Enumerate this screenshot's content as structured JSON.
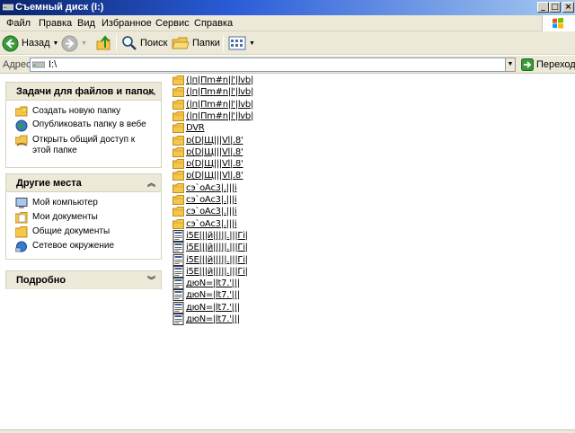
{
  "window": {
    "title": "Съемный диск (I:)"
  },
  "menu": [
    "Файл",
    "Правка",
    "Вид",
    "Избранное",
    "Сервис",
    "Справка"
  ],
  "toolbar": {
    "back": "Назад",
    "search": "Поиск",
    "folders": "Папки"
  },
  "address": {
    "label": "Адрес:",
    "value": "I:\\",
    "go": "Переход"
  },
  "panels": {
    "tasks": {
      "title": "Задачи для файлов и папок",
      "items": [
        "Создать новую папку",
        "Опубликовать папку в вебе",
        "Открыть общий доступ к этой папке"
      ]
    },
    "places": {
      "title": "Другие места",
      "items": [
        "Мой компьютер",
        "Мои документы",
        "Общие документы",
        "Сетевое окружение"
      ]
    },
    "details": {
      "title": "Подробно"
    }
  },
  "files": [
    {
      "name": "(|п|Пm#n|l'|lvb|",
      "type": "folder"
    },
    {
      "name": "(|п|Пm#n|l'|lvb|",
      "type": "folder"
    },
    {
      "name": "(|п|Пm#n|l'|lvb|",
      "type": "folder"
    },
    {
      "name": "(|п|Пm#n|l'|lvb|",
      "type": "folder"
    },
    {
      "name": "DVR",
      "type": "folder"
    },
    {
      "name": "ɒ(D|Щ|||Vl|.8'",
      "type": "folder"
    },
    {
      "name": "ɒ(D|Щ|||Vl|.8'",
      "type": "folder"
    },
    {
      "name": "ɒ(D|Щ|||Vl|.8'",
      "type": "folder"
    },
    {
      "name": "ɒ(D|Щ|||Vl|.8'",
      "type": "folder"
    },
    {
      "name": "сэ`оАс3|.|||і",
      "type": "folder"
    },
    {
      "name": "сэ`оАс3|.|||і",
      "type": "folder"
    },
    {
      "name": "сэ`оАс3|.|||і",
      "type": "folder"
    },
    {
      "name": "сэ`оАс3|.|||і",
      "type": "folder"
    },
    {
      "name": "і5Е|||й|||||.|||Гі|",
      "type": "file"
    },
    {
      "name": "і5Е|||й|||||.|||Гі|",
      "type": "file"
    },
    {
      "name": "і5Е|||й|||||.|||Гі|",
      "type": "file"
    },
    {
      "name": "і5Е|||й|||||.|||Гі|",
      "type": "file"
    },
    {
      "name": "дюN=|lt7.'|||",
      "type": "file"
    },
    {
      "name": "дюN=|lt7.'|||",
      "type": "file"
    },
    {
      "name": "дюN=|lt7.'|||",
      "type": "file"
    },
    {
      "name": "дюN=|lt7.'|||",
      "type": "file"
    }
  ]
}
